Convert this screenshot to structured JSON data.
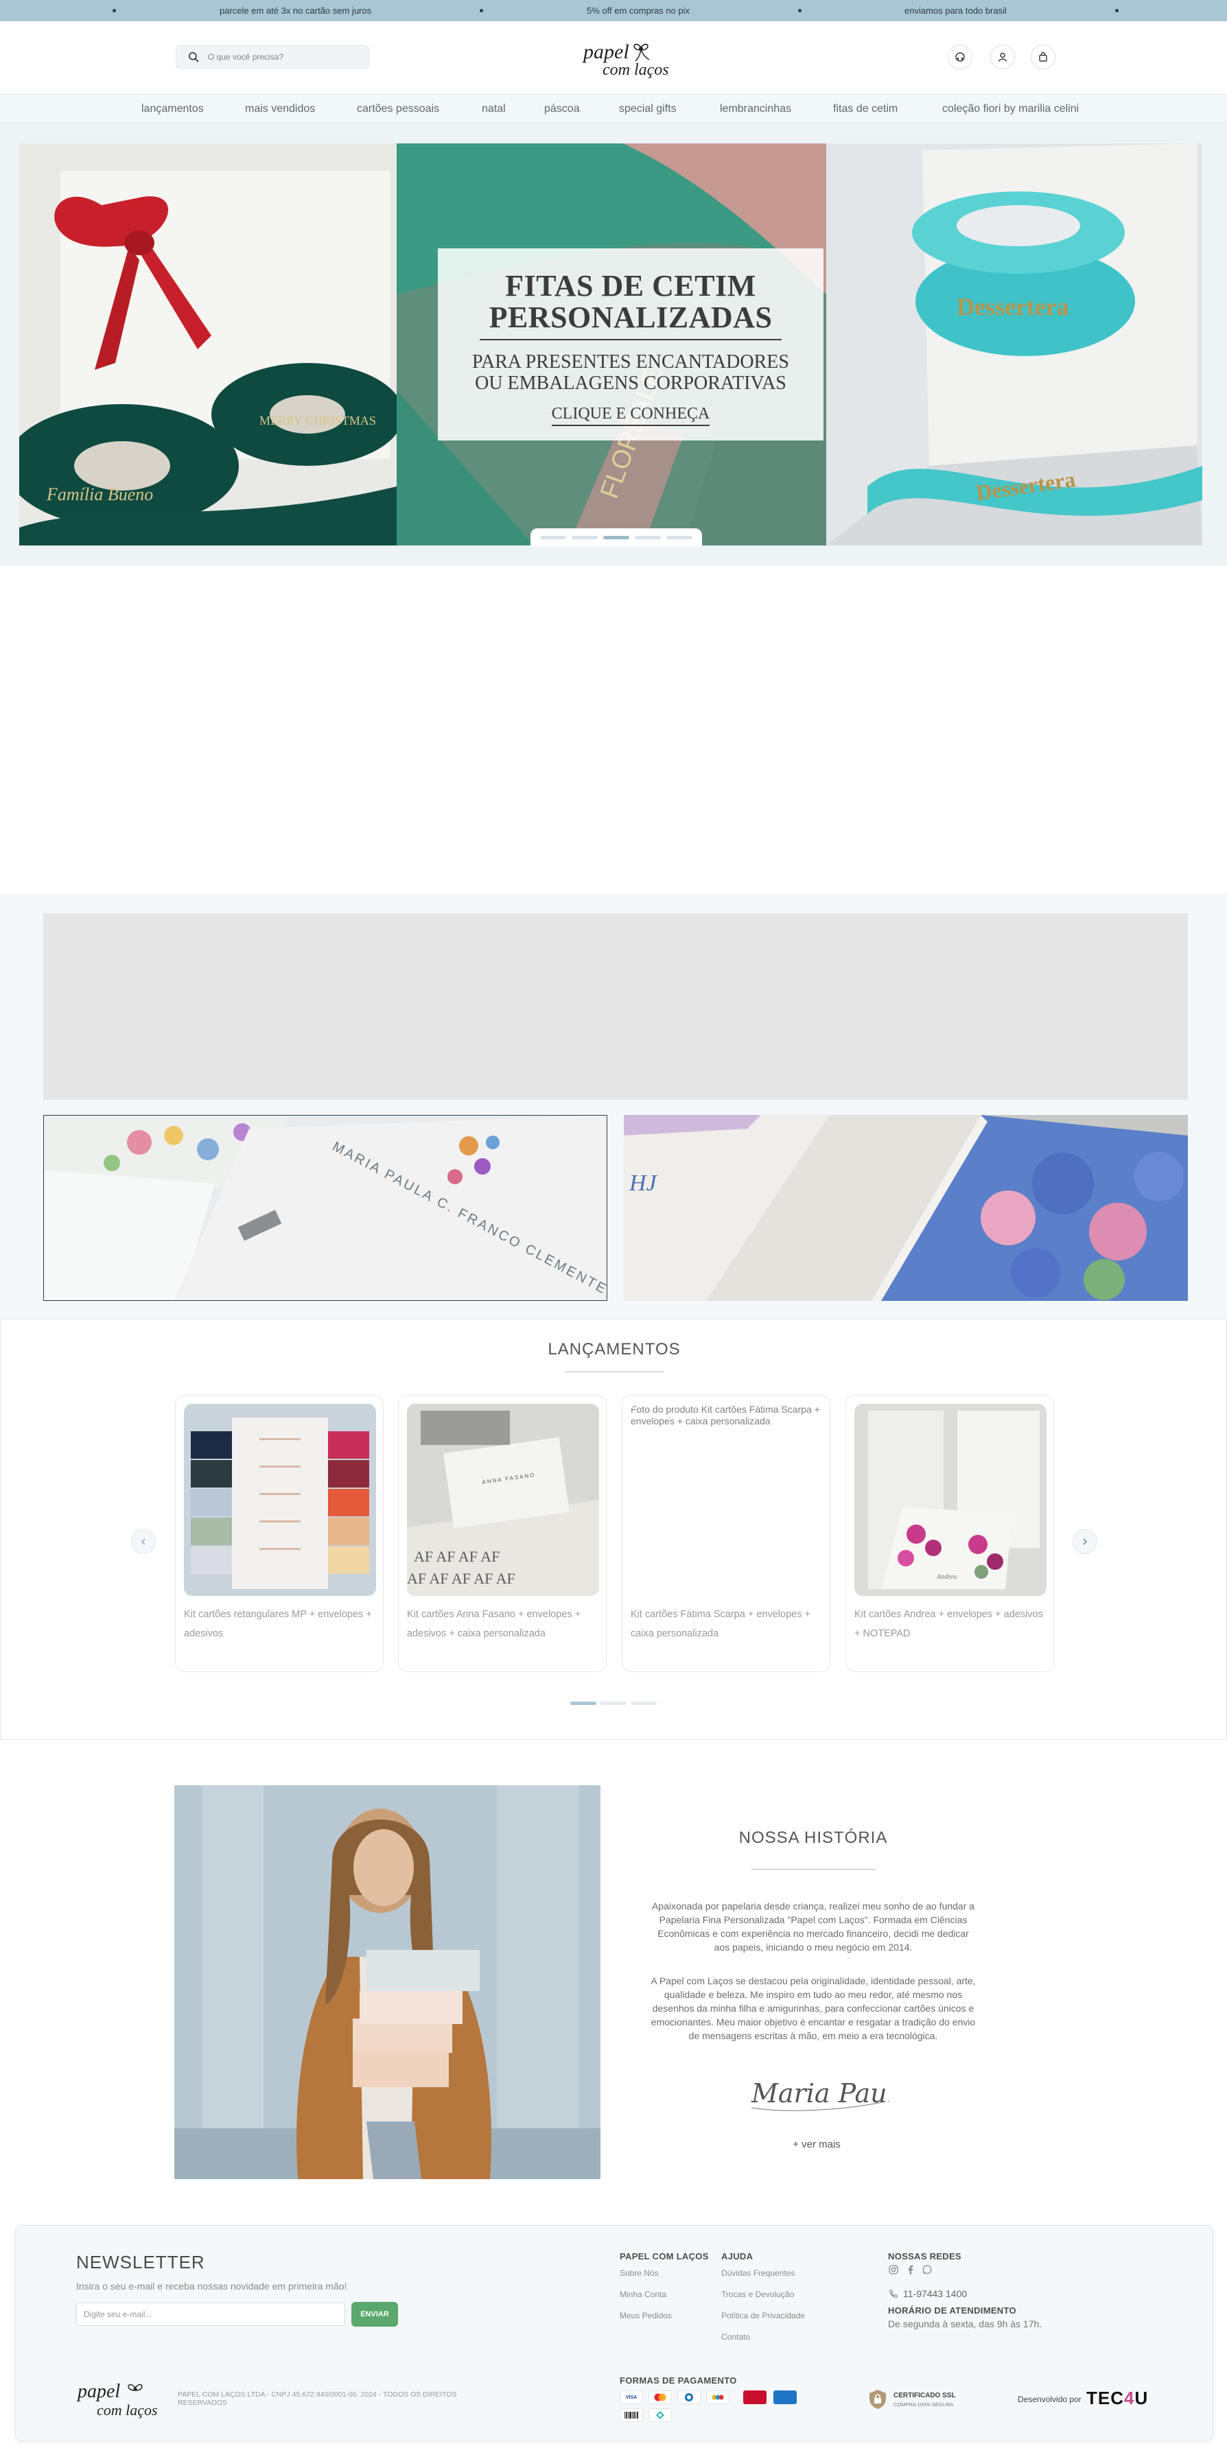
{
  "promo_bar": {
    "messages": [
      "parcele em até 3x no cartão sem juros",
      "5% off em compras no pix",
      "enviamos para todo brasil"
    ]
  },
  "header": {
    "search_placeholder": "O que você precisa?",
    "logo_text_line1": "papel",
    "logo_text_line2": "com laços"
  },
  "nav": {
    "items": [
      "lançamentos",
      "mais vendidos",
      "cartões pessoais",
      "natal",
      "páscoa",
      "special gifts",
      "lembrancinhas",
      "fitas de cetim",
      "coleção fiori by marilia celini"
    ]
  },
  "hero": {
    "title_line1": "FITAS DE CETIM",
    "title_line2": "PERSONALIZADAS",
    "subtitle_line1": "PARA PRESENTES ENCANTADORES",
    "subtitle_line2": "OU EMBALAGENS CORPORATIVAS",
    "cta": "CLIQUE E CONHEÇA",
    "ribbon_text_left_1": "Família Bueno",
    "ribbon_text_left_2": "MERRY CHRISTMAS",
    "ribbon_text_right": "Dessertera",
    "ribbon_text_middle": "FLOREALE",
    "slides": 5,
    "active_slide": 3,
    "colors": {
      "ribbon_red": "#c8202a",
      "ribbon_green": "#0e4a40",
      "ribbon_teal": "#3fc3c8",
      "ribbon_mint": "#3c9a82",
      "ribbon_pink": "#c49a92"
    }
  },
  "banner_area": {
    "card_text": "MARIA PAULA C. FRANCO CLEMENTE",
    "monogram_text": "HJ"
  },
  "launches": {
    "title": "LANÇAMENTOS",
    "products": [
      {
        "name": "Kit cartões retangulares MP + envelopes + adesivos",
        "image_alt": ""
      },
      {
        "name": "Kit cartões Anna Fasano + envelopes + adesivos + caixa personalizada",
        "image_alt": "",
        "card_print": "ANNA FASANO"
      },
      {
        "name": "Kit cartões Fátima Scarpa + envelopes + caixa personalizada",
        "image_alt": "Foto do produto Kit cartões Fátima Scarpa + envelopes + caixa personalizada"
      },
      {
        "name": "Kit cartões Andrea + envelopes + adesivos + NOTEPAD",
        "image_alt": ""
      }
    ],
    "pages": 3,
    "active_page": 1
  },
  "history": {
    "title": "NOSSA HISTÓRIA",
    "paragraph1": "Apaixonada por papelaria desde criança, realizei meu sonho de ao fundar a Papelaria Fina Personalizada \"Papel com Laços\". Formada em Ciências Econômicas e com experiência no mercado financeiro, decidi me dedicar aos papeis, iniciando o meu negócio em 2014.",
    "paragraph2": "A Papel com Laços se destacou pela originalidade, identidade pessoal, arte, qualidade e beleza. Me inspiro em tudo ao meu redor, até mesmo nos desenhos da minha filha e amigurinhas, para confeccionar cartões únicos e emocionantes. Meu maior objetivo é encantar e resgatar a tradição do envio de mensagens escritas à mão, em meio a era tecnológica.",
    "signature": "Maria Paula",
    "more_link": "+ ver mais"
  },
  "footer": {
    "newsletter_title": "NEWSLETTER",
    "newsletter_subtitle": "Insira o seu e-mail e receba nossas novidade em primeira mão!",
    "email_placeholder": "Digite seu e-mail...",
    "submit_label": "ENVIAR",
    "col1_title": "PAPEL COM LAÇOS",
    "col1_links": [
      "Sobre Nós",
      "Minha Conta",
      "Meus Pedidos"
    ],
    "col2_title": "AJUDA",
    "col2_links": [
      "Dúvidas Frequentes",
      "Trocas e Devolução",
      "Política de Privacidade",
      "Contato"
    ],
    "social_title": "NOSSAS REDES",
    "phone": "11-97443 1400",
    "hours_title": "HORÁRIO DE ATENDIMENTO",
    "hours": "De segunda à sexta, das 9h às 17h.",
    "legal": "PAPEL COM LAÇOS LTDA - CNPJ 45.672.940/0001-00. 2024 - TODOS OS DIREITOS RESERVADOS",
    "payment_title": "FORMAS DE PAGAMENTO",
    "payment_methods": [
      "VISA",
      "Mastercard",
      "Diners",
      "Elo",
      "Hipercard",
      "Amex",
      "Boleto",
      "Pix"
    ],
    "ssl_title": "CERTIFICADO SSL",
    "ssl_sub": "COMPRA 100% SEGURA",
    "developed_by": "Desenvolvido por",
    "dev_brand_a": "TEC",
    "dev_brand_b": "4",
    "dev_brand_c": "U"
  }
}
